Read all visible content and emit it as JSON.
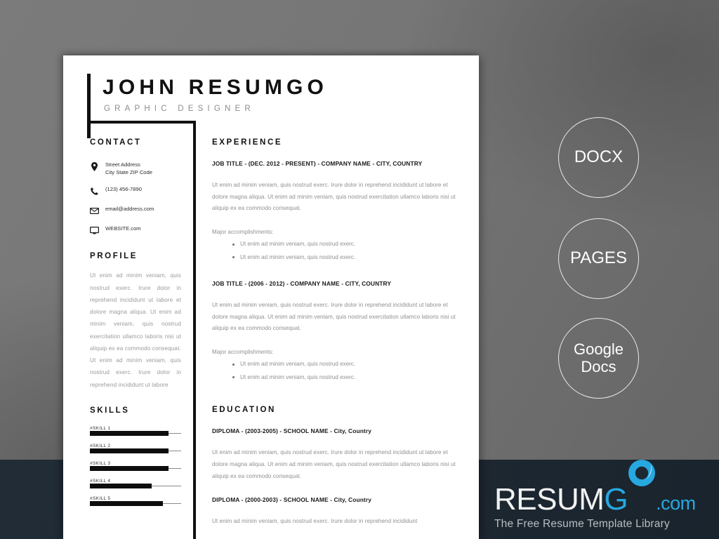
{
  "background": {
    "gray": "#757575",
    "footer_navy": "#202b36"
  },
  "resume": {
    "name": "JOHN RESUMGO",
    "subtitle": "GRAPHIC DESIGNER",
    "contact": {
      "heading": "CONTACT",
      "items": [
        {
          "icon": "location-pin-icon",
          "line1": "Street Address",
          "line2": "City State ZIP Code"
        },
        {
          "icon": "phone-icon",
          "line1": "(123) 456-7890",
          "line2": ""
        },
        {
          "icon": "envelope-icon",
          "line1": "email@address.com",
          "line2": ""
        },
        {
          "icon": "monitor-icon",
          "line1": "WEBSITE.com",
          "line2": ""
        }
      ]
    },
    "profile": {
      "heading": "PROFILE",
      "body": "Ut enim ad minim veniam, quis nostrud exerc. Irure dolor in reprehend incididunt ut labore et dolore magna aliqua. Ut enim ad minim veniam, quis nostrud exercitation ullamco laboris nisi ut aliquip ex ea commodo consequat. Ut enim ad minim veniam, quis nostrud exerc. Irure dolor in reprehend incididunt ut labore"
    },
    "skills": {
      "heading": "SKILLS",
      "items": [
        {
          "label": "#SKILL 1",
          "percent": 86
        },
        {
          "label": "#SKILL 2",
          "percent": 86
        },
        {
          "label": "#SKILL 3",
          "percent": 86
        },
        {
          "label": "#SKILL 4",
          "percent": 68
        },
        {
          "label": "#SKILL 5",
          "percent": 80
        }
      ]
    },
    "experience": {
      "heading": "EXPERIENCE",
      "entries": [
        {
          "title": "JOB TITLE - (DEC. 2012 - PRESENT) - COMPANY NAME - CITY, COUNTRY",
          "body": "Ut enim ad minim veniam, quis nostrud exerc. Irure dolor in reprehend incididunt ut labore et dolore magna aliqua. Ut enim ad minim veniam, quis nostrud exercitation ullamco laboris nisi ut aliquip ex ea commodo consequat.",
          "accomplishments_label": "Major accomplishments:",
          "bullets": [
            "Ut enim ad minim veniam, quis nostrud exerc.",
            "Ut enim ad minim veniam, quis nostrud exerc."
          ]
        },
        {
          "title": "JOB TITLE - (2006 - 2012)  - COMPANY NAME - CITY, COUNTRY",
          "body": "Ut enim ad minim veniam, quis nostrud exerc. Irure dolor in reprehend incididunt ut labore et dolore magna aliqua. Ut enim ad minim veniam, quis nostrud exercitation ullamco laboris nisi ut aliquip ex ea commodo consequat.",
          "accomplishments_label": "Major accomplishments:",
          "bullets": [
            "Ut enim ad minim veniam, quis nostrud exerc.",
            "Ut enim ad minim veniam, quis nostrud exerc."
          ]
        }
      ]
    },
    "education": {
      "heading": "EDUCATION",
      "entries": [
        {
          "title": "DIPLOMA - (2003-2005)  - SCHOOL NAME - City, Country",
          "body": "Ut enim ad minim veniam, quis nostrud exerc. Irure dolor in reprehend incididunt ut labore et dolore magna aliqua. Ut enim ad minim veniam, quis nostrud exercitation ullamco laboris nisi ut aliquip ex ea commodo consequat."
        },
        {
          "title": "DIPLOMA - (2000-2003)  -  SCHOOL NAME - City, Country",
          "body": "Ut enim ad minim veniam, quis nostrud exerc. Irure dolor in reprehend incididunt"
        }
      ]
    }
  },
  "format_badges": [
    {
      "label": "DOCX",
      "name": "badge-docx"
    },
    {
      "label": "PAGES",
      "name": "badge-pages"
    },
    {
      "label": "Google\nDocs",
      "name": "badge-google-docs"
    }
  ],
  "logo": {
    "part_white": "RESUM",
    "part_accent_g": "G",
    "part_accent_o": "O",
    "part_tld": ".com",
    "tagline": "The Free Resume Template Library",
    "accent_color": "#27a8e0",
    "white_color": "#f2f2f2"
  }
}
